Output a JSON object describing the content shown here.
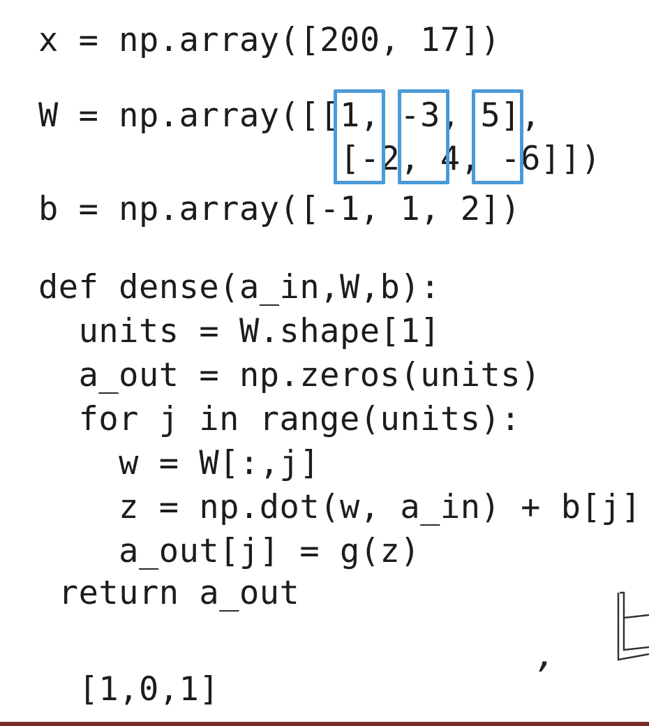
{
  "code": {
    "x_line": "x = np.array([200, 17])",
    "w_line1": "W = np.array([[1, -3, 5],",
    "w_line2": "               [-2, 4, -6]])",
    "b_line": "b = np.array([-1, 1, 2])",
    "def_line": "def dense(a_in,W,b):",
    "units_line": "  units = W.shape[1]",
    "aout_line": "  a_out = np.zeros(units)",
    "for_line": "  for j in range(units):",
    "w_col_line": "    w = W[:,j]",
    "z_line": "    z = np.dot(w, a_in) + b[j]",
    "g_line": "    a_out[j] = g(z)",
    "return_line": " return a_out",
    "result_line": "  [1,0,1]"
  },
  "overlay": {
    "comma": ","
  },
  "colors": {
    "highlight": "#4a9ad8",
    "footer": "#7a2a2a",
    "text": "#1c1c1c"
  }
}
